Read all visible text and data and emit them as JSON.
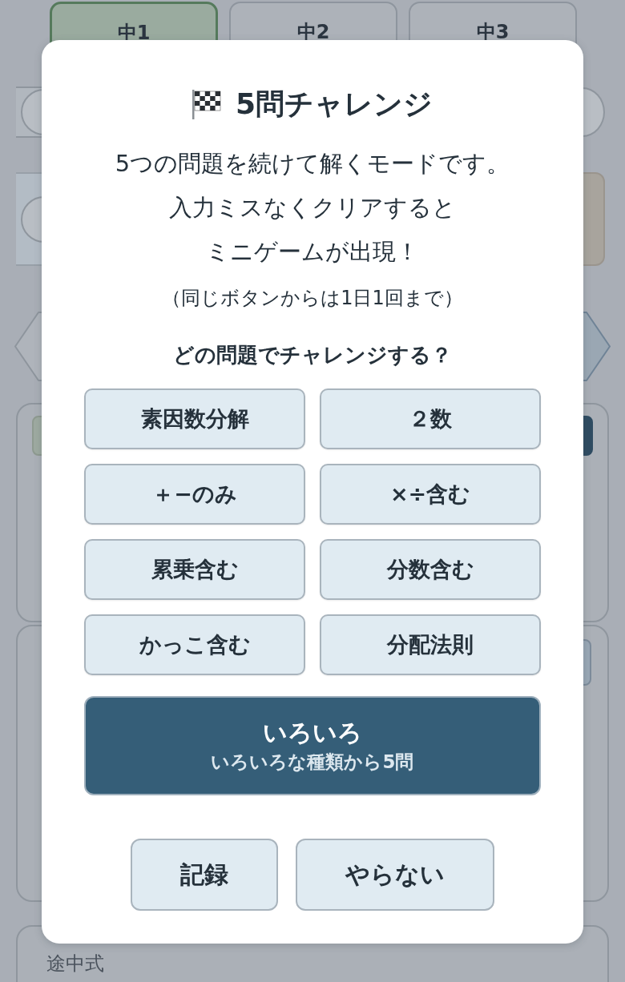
{
  "background_page": {
    "grade_tabs": [
      {
        "label": "中1",
        "selected": true
      },
      {
        "label": "中2",
        "selected": false
      },
      {
        "label": "中3",
        "selected": false
      }
    ],
    "work_label": "途中式"
  },
  "dialog": {
    "title": "5問チャレンジ",
    "description_lines": [
      "5つの問題を続けて解くモードです。",
      "入力ミスなくクリアすると",
      "ミニゲームが出現！"
    ],
    "note": "（同じボタンからは1日1回まで）",
    "question": "どの問題でチャレンジする？",
    "choices": [
      {
        "label": "素因数分解"
      },
      {
        "label": "２数"
      },
      {
        "label": "＋−のみ"
      },
      {
        "label": "×÷含む"
      },
      {
        "label": "累乗含む"
      },
      {
        "label": "分数含む"
      },
      {
        "label": "かっこ含む"
      },
      {
        "label": "分配法則"
      }
    ],
    "featured_choice": {
      "label": "いろいろ",
      "sublabel": "いろいろな種類から5問"
    },
    "actions": [
      {
        "label": "記録"
      },
      {
        "label": "やらない"
      }
    ]
  }
}
